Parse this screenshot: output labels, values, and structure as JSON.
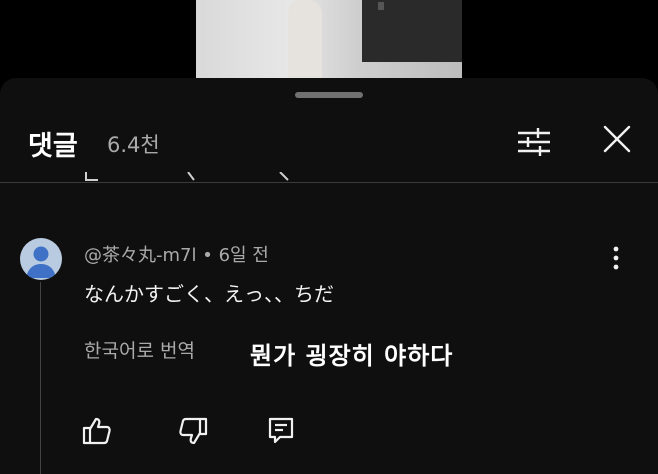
{
  "header": {
    "title": "댓글",
    "count": "6.4천"
  },
  "comment": {
    "author": "@茶々丸-m7l",
    "separator": "•",
    "time": "6일 전",
    "text": "なんかすごく、えっ、、ちだ",
    "translate_label": "한국어로 번역",
    "overlay_translation": "뭔가 굉장히 야하다"
  },
  "icons": {
    "filter": "filter-icon",
    "close": "close-icon",
    "more": "more-vert-icon",
    "like": "thumb-up-icon",
    "dislike": "thumb-down-icon",
    "reply": "reply-icon"
  },
  "colors": {
    "sheet_background": "#0f0f0f",
    "primary_text": "#f1f1f1",
    "secondary_text": "#aaaaaa",
    "avatar": "#b9cbe0"
  }
}
